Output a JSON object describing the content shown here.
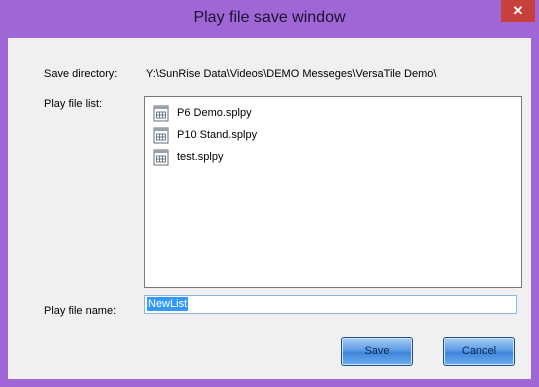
{
  "window": {
    "title": "Play file save window",
    "close_glyph": "✕"
  },
  "form": {
    "save_directory_label": "Save directory:",
    "save_directory_value": "Y:\\SunRise Data\\Videos\\DEMO Messeges\\VersaTile Demo\\",
    "play_file_list_label": "Play file list:",
    "play_file_name_label": "Play file name:",
    "play_file_name_value": "NewList"
  },
  "files": [
    {
      "name": "P6 Demo.splpy",
      "icon": "file-icon"
    },
    {
      "name": "P10 Stand.splpy",
      "icon": "file-icon"
    },
    {
      "name": "test.splpy",
      "icon": "file-icon"
    }
  ],
  "buttons": {
    "save_label": "Save",
    "cancel_label": "Cancel"
  },
  "colors": {
    "title_bar": "#9f67d6",
    "close_button": "#c7403b",
    "button_blue": "#5c9ce6",
    "selection": "#3399ff"
  }
}
